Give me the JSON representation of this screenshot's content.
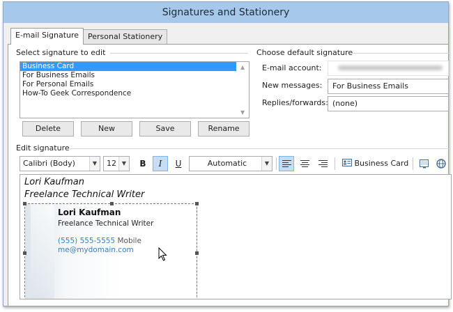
{
  "window": {
    "title": "Signatures and Stationery"
  },
  "tabs": [
    {
      "label": "E-mail Signature",
      "active": true
    },
    {
      "label": "Personal Stationery",
      "active": false
    }
  ],
  "select_signature": {
    "label": "Select signature to edit",
    "items": [
      "Business Card",
      "For Business Emails",
      "For Personal Emails",
      "How-To Geek Correspondence"
    ],
    "selected_index": 0
  },
  "buttons": {
    "delete": "Delete",
    "new": "New",
    "save": "Save",
    "rename": "Rename"
  },
  "default_signature": {
    "label": "Choose default signature",
    "email_account_label": "E-mail account:",
    "new_messages_label": "New messages:",
    "new_messages_value": "For Business Emails",
    "replies_label": "Replies/forwards:",
    "replies_value": "(none)"
  },
  "edit_signature": {
    "label": "Edit signature",
    "font_name": "Calibri (Body)",
    "font_size": "12",
    "bold": "B",
    "italic": "I",
    "underline": "U",
    "color": "Automatic",
    "business_card_button": "Business Card",
    "active_alignment": "left",
    "italic_pressed": true
  },
  "signature_content": {
    "line1": "Lori Kaufman",
    "line2": "Freelance Technical Writer",
    "card": {
      "name": "Lori Kaufman",
      "title": "Freelance Technical Writer",
      "phone": "(555) 555-5555",
      "phone_type": "Mobile",
      "email": "me@mydomain.com"
    }
  },
  "colors": {
    "titlebar": "#a6c8ea",
    "selection": "#3399ff",
    "link": "#3a7bbf",
    "pressed": "#c5ddf5"
  },
  "icons": [
    "chevron-down-icon",
    "align-left-icon",
    "align-center-icon",
    "align-right-icon",
    "business-card-icon",
    "insert-picture-icon",
    "hyperlink-icon",
    "mouse-pointer-icon"
  ]
}
